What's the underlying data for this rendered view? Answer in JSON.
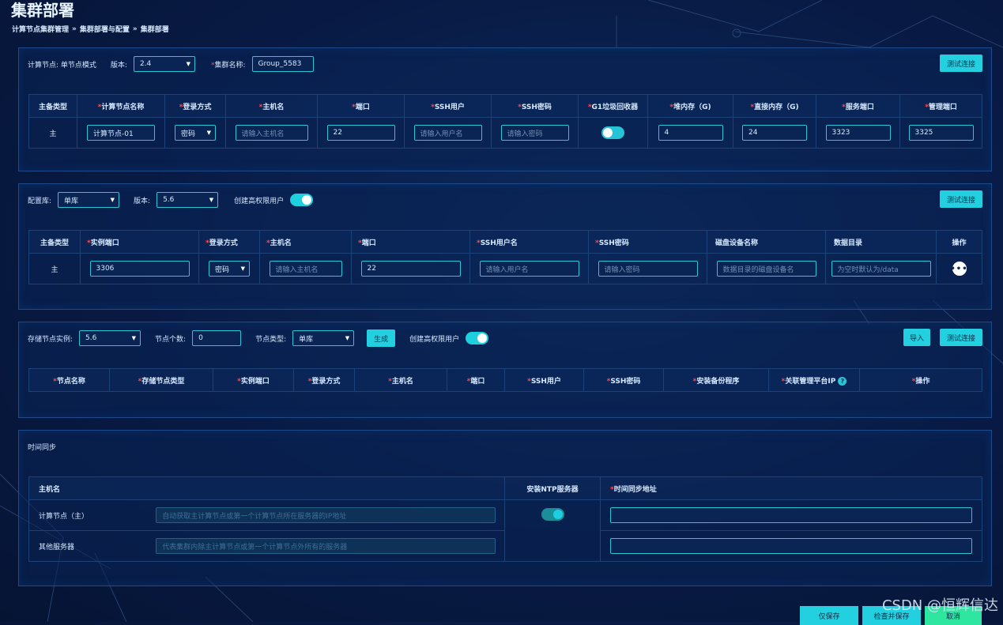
{
  "page_title": "集群部署",
  "breadcrumb": [
    "计算节点集群管理",
    "集群部署与配置",
    "集群部署"
  ],
  "breadcrumb_sep": "»",
  "section1": {
    "mode_label": "计算节点: 单节点模式",
    "version_label": "版本:",
    "version_value": "2.4",
    "group_label": "集群名称:",
    "group_value": "Group_5583",
    "test_btn": "测试连接",
    "headers": [
      "主备类型",
      "计算节点名称",
      "登录方式",
      "主机名",
      "端口",
      "SSH用户",
      "SSH密码",
      "G1垃圾回收器",
      "堆内存（G)",
      "直接内存（G)",
      "服务端口",
      "管理端口"
    ],
    "row": {
      "type": "主",
      "name": "计算节点-01",
      "login": "密码",
      "host_ph": "请输入主机名",
      "port": "22",
      "ssh_user_ph": "请输入用户名",
      "ssh_pass_ph": "请输入密码",
      "heap": "4",
      "direct": "24",
      "service_port": "3323",
      "manage_port": "3325"
    }
  },
  "section2": {
    "config_label": "配置库:",
    "config_value": "单库",
    "version_label": "版本:",
    "version_value": "5.6",
    "create_user_label": "创建高权限用户",
    "test_btn": "测试连接",
    "headers": [
      "主备类型",
      "实例端口",
      "登录方式",
      "主机名",
      "端口",
      "SSH用户名",
      "SSH密码",
      "磁盘设备名称",
      "数据目录",
      "操作"
    ],
    "row": {
      "type": "主",
      "port": "3306",
      "login": "密码",
      "host_ph": "请输入主机名",
      "ssh_port": "22",
      "ssh_user_ph": "请输入用户名",
      "ssh_pass_ph": "请输入密码",
      "disk_ph": "数据目录的磁盘设备名",
      "dir_ph": "为空时默认为/data",
      "op": "•••"
    }
  },
  "section3": {
    "instance_label": "存储节点实例:",
    "instance_value": "5.6",
    "count_label": "节点个数:",
    "count_value": "0",
    "type_label": "节点类型:",
    "type_value": "单库",
    "generate_btn": "生成",
    "create_user_label": "创建高权限用户",
    "import_btn": "导入",
    "test_btn": "测试连接",
    "headers": [
      "节点名称",
      "存储节点类型",
      "实例端口",
      "登录方式",
      "主机名",
      "端口",
      "SSH用户",
      "SSH密码",
      "安装备份程序",
      "关联管理平台IP",
      "操作"
    ]
  },
  "section4": {
    "title": "时间同步",
    "headers": [
      "主机名",
      "安装NTP服务器",
      "时间同步地址"
    ],
    "rows": [
      {
        "name": "计算节点（主）",
        "ph": "自动获取主计算节点或第一个计算节点所在服务器的IP地址"
      },
      {
        "name": "其他服务器",
        "ph": "代表集群内除主计算节点或第一个计算节点外所有的服务器"
      }
    ]
  },
  "footer": {
    "save_only": "仅保存",
    "check_save": "检查并保存",
    "cancel": "取消"
  },
  "watermark": "CSDN @恒辉信达",
  "colors": {
    "accent": "#23d0e0",
    "cancel": "#2ee6a0",
    "required": "#ff4d4f",
    "background": "#081a44"
  }
}
